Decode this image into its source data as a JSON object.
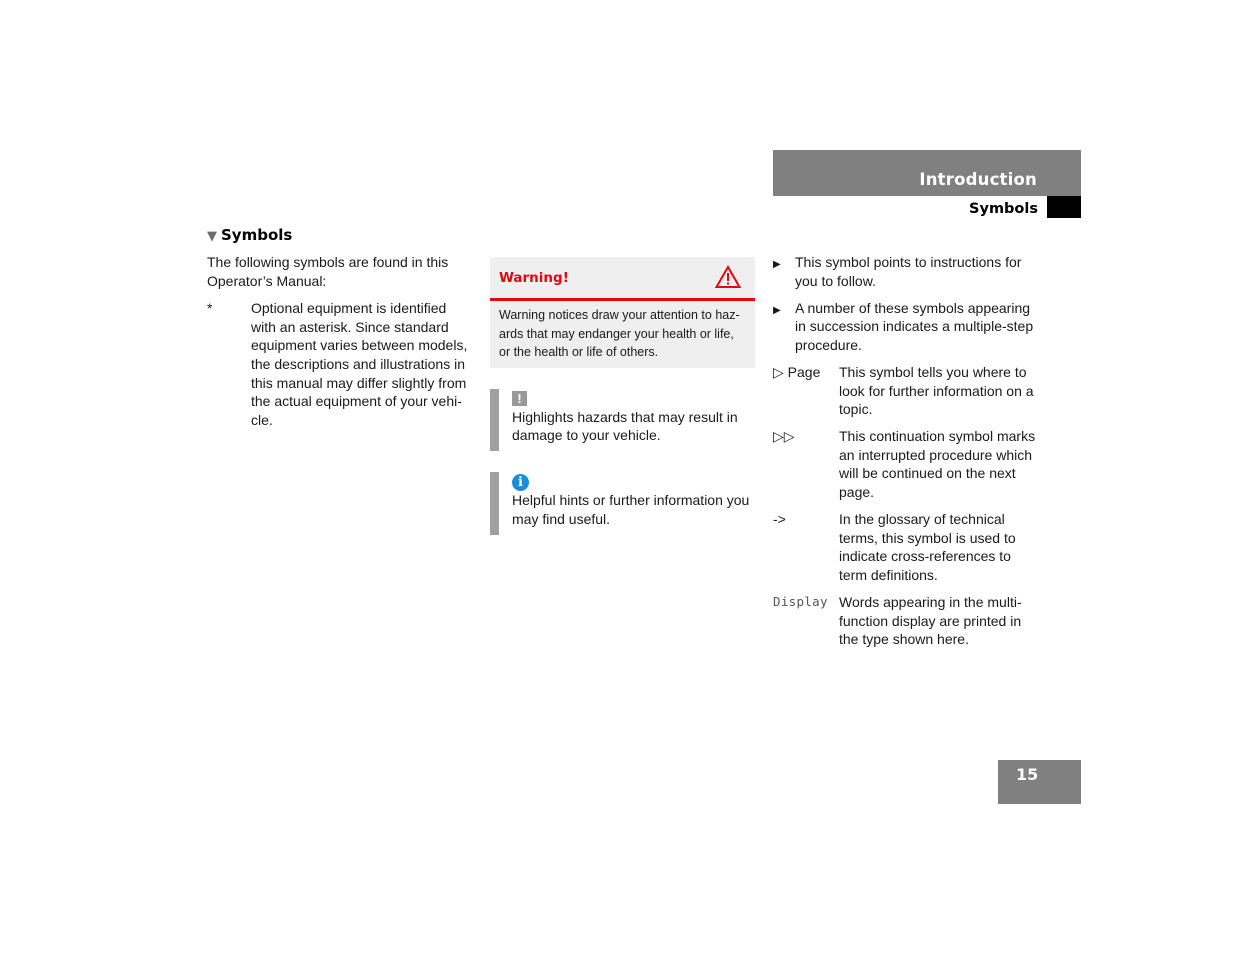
{
  "header": {
    "chapter": "Introduction",
    "section": "Symbols"
  },
  "section_heading": {
    "icon": "triangle-down-icon",
    "label": "Symbols"
  },
  "intro": {
    "text": "The following symbols are found in this Operator’s Manual:",
    "items": [
      {
        "symbol": "*",
        "description": "Optional equipment is identified with an asterisk. Since standard equipment varies between models, the descriptions and illustrations in this manual may differ slightly from the actual equipment of your vehi-cle."
      }
    ]
  },
  "warning_box": {
    "title": "Warning!",
    "icon": "warning-triangle-icon",
    "text": "Warning notices draw your attention to haz-ards that may endanger your health or life, or the health or life of others.",
    "accent_color": "#e30613"
  },
  "notes": [
    {
      "icon": "exclamation-icon",
      "glyph": "!",
      "text": "Highlights hazards that may result in damage to your vehicle."
    },
    {
      "icon": "info-icon",
      "glyph": "i",
      "text": "Helpful hints or further information you may find useful."
    }
  ],
  "instructions": [
    {
      "icon": "arrow-right-icon",
      "glyph": "▶",
      "text": "This symbol points to instructions for you to follow."
    },
    {
      "icon": "arrow-right-icon",
      "glyph": "▶",
      "text": "A number of these symbols appearing in succession indicates a multiple-step procedure."
    }
  ],
  "symbol_list": [
    {
      "symbol": "▷ Page",
      "text": "This symbol tells you where to look for further information on a topic."
    },
    {
      "symbol": "▷▷",
      "text": "This continuation symbol marks an interrupted procedure which will be continued on the next page."
    },
    {
      "symbol": "->",
      "text": "In the glossary of technical terms, this symbol is used to indicate cross-references to term definitions."
    },
    {
      "symbol": "Display",
      "text": "Words appearing in the multi-function display are printed in the type shown here."
    }
  ],
  "page_number": "15"
}
